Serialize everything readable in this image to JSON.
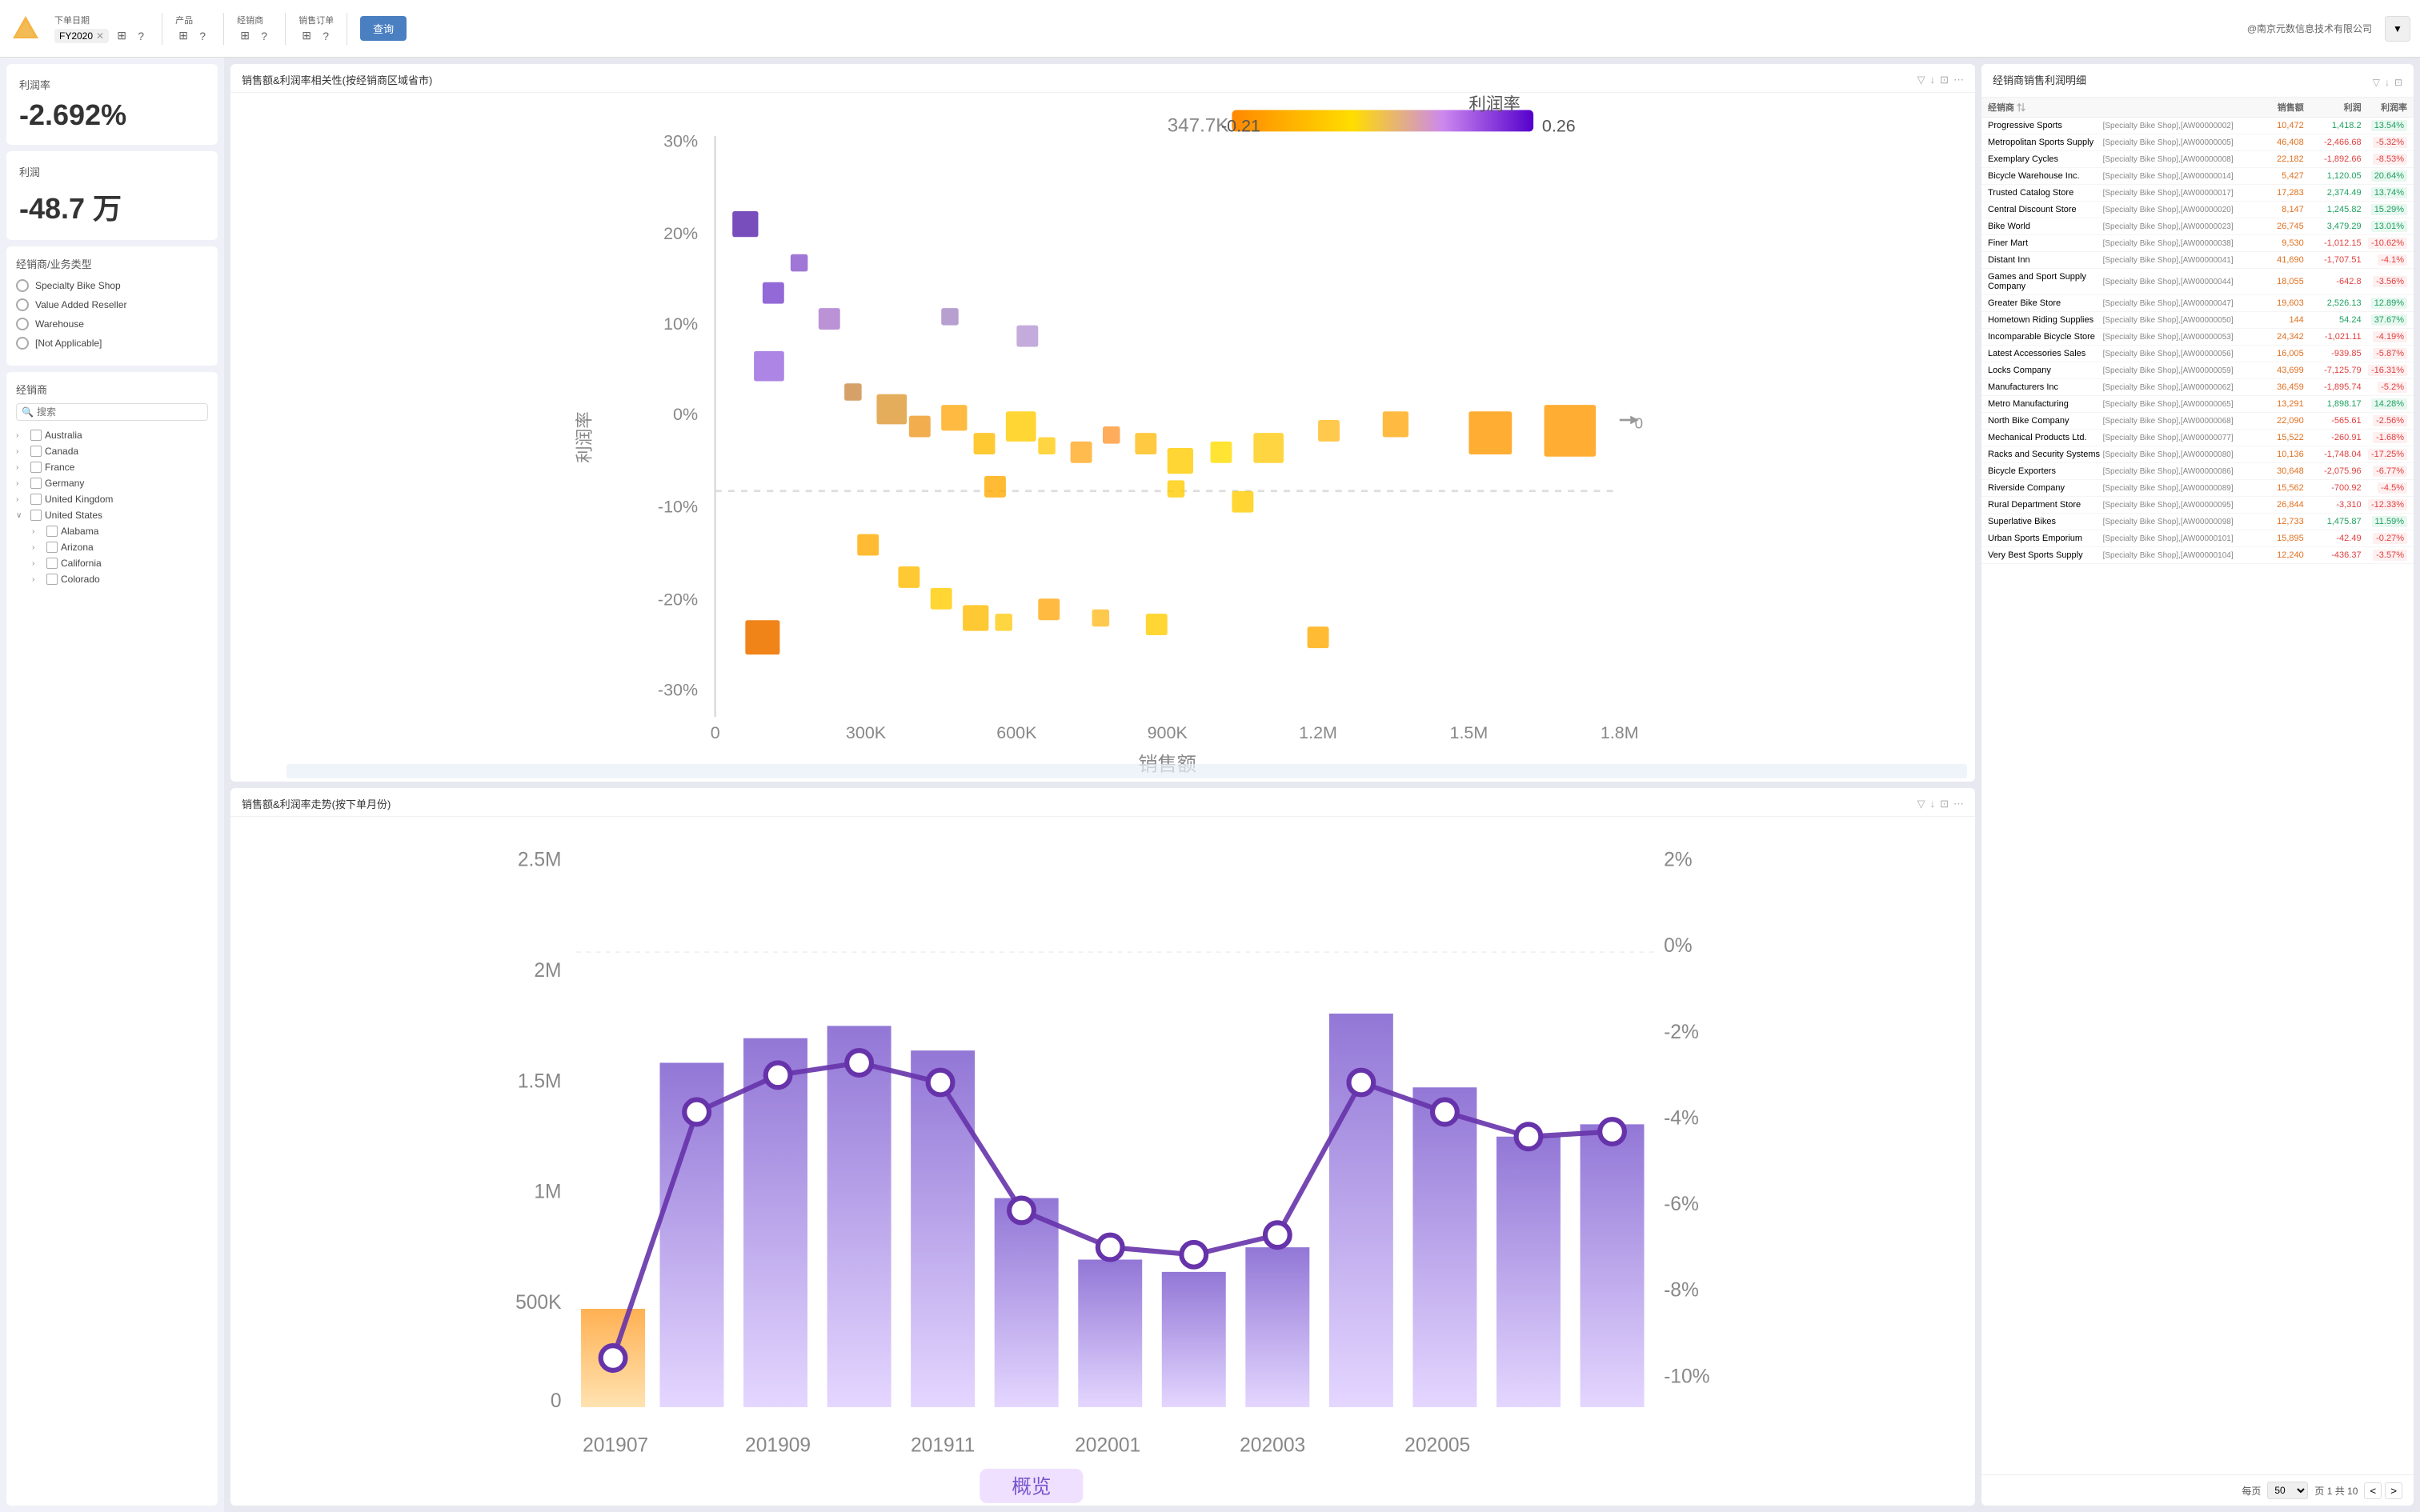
{
  "toolbar": {
    "logo_color": "#f5a623",
    "filters": [
      {
        "label": "下单日期",
        "tag": "FY2020",
        "has_close": true
      },
      {
        "label": "产品",
        "tag": null
      },
      {
        "label": "经销商",
        "tag": null
      },
      {
        "label": "销售订单",
        "tag": null
      }
    ],
    "query_btn": "查询",
    "company": "@南京元数信息技术有限公司"
  },
  "left": {
    "kpi1": {
      "label": "利润率",
      "value": "-2.692%"
    },
    "kpi2": {
      "label": "利润",
      "value": "-48.7 万"
    },
    "filter_title": "经销商/业务类型",
    "filter_items": [
      "Specialty Bike Shop",
      "Value Added Reseller",
      "Warehouse",
      "[Not Applicable]"
    ],
    "tree_title": "经销商",
    "search_placeholder": "搜索",
    "tree_items": [
      {
        "label": "Australia",
        "expanded": false,
        "checked": false,
        "children": []
      },
      {
        "label": "Canada",
        "expanded": false,
        "checked": false,
        "children": []
      },
      {
        "label": "France",
        "expanded": false,
        "checked": false,
        "children": []
      },
      {
        "label": "Germany",
        "expanded": false,
        "checked": false,
        "children": []
      },
      {
        "label": "United Kingdom",
        "expanded": false,
        "checked": false,
        "children": []
      },
      {
        "label": "United States",
        "expanded": true,
        "checked": false,
        "children": [
          "Alabama",
          "Arizona",
          "California",
          "Colorado"
        ]
      }
    ]
  },
  "scatter_chart": {
    "title": "销售额&利润率相关性(按经销商区域省市)",
    "x_label": "销售额",
    "y_label": "利润率",
    "max_bubble": "347.7K",
    "color_min": "-0.21",
    "color_max": "0.26",
    "color_label": "利润率",
    "x_ticks": [
      "0",
      "300K",
      "600K",
      "900K",
      "1.2M",
      "1.5M",
      "1.8M"
    ],
    "y_ticks": [
      "30%",
      "20%",
      "10%",
      "0%",
      "-10%",
      "-20%",
      "-30%"
    ]
  },
  "trend_chart": {
    "title": "销售额&利润率走势(按下单月份)",
    "y_left_ticks": [
      "2.5M",
      "2M",
      "1.5M",
      "1M",
      "500K",
      "0"
    ],
    "y_right_ticks": [
      "2%",
      "0%",
      "-2%",
      "-4%",
      "-6%",
      "-8%",
      "-10%"
    ],
    "x_ticks": [
      "201907",
      "201909",
      "201911",
      "202001",
      "202003",
      "202005"
    ]
  },
  "right_table": {
    "title": "经销商销售利润明细",
    "col_dealer": "经销商",
    "col_id": "",
    "col_sales": "销售额",
    "col_profit": "利润",
    "col_rate": "利润率",
    "rows": [
      {
        "dealer": "Progressive Sports",
        "id": "[Specialty Bike Shop],[AW00000002]",
        "sales": "10,472",
        "profit": "1,418.2",
        "rate": "13.54%",
        "profit_pos": true,
        "rate_pos": true
      },
      {
        "dealer": "Metropolitan Sports Supply",
        "id": "[Specialty Bike Shop],[AW00000005]",
        "sales": "46,408",
        "profit": "-2,466.68",
        "rate": "-5.32%",
        "profit_pos": false,
        "rate_pos": false
      },
      {
        "dealer": "Exemplary Cycles",
        "id": "[Specialty Bike Shop],[AW00000008]",
        "sales": "22,182",
        "profit": "-1,892.66",
        "rate": "-8.53%",
        "profit_pos": false,
        "rate_pos": false
      },
      {
        "dealer": "Bicycle Warehouse Inc.",
        "id": "[Specialty Bike Shop],[AW00000014]",
        "sales": "5,427",
        "profit": "1,120.05",
        "rate": "20.64%",
        "profit_pos": true,
        "rate_pos": true
      },
      {
        "dealer": "Trusted Catalog Store",
        "id": "[Specialty Bike Shop],[AW00000017]",
        "sales": "17,283",
        "profit": "2,374.49",
        "rate": "13.74%",
        "profit_pos": true,
        "rate_pos": true
      },
      {
        "dealer": "Central Discount Store",
        "id": "[Specialty Bike Shop],[AW00000020]",
        "sales": "8,147",
        "profit": "1,245.82",
        "rate": "15.29%",
        "profit_pos": true,
        "rate_pos": true
      },
      {
        "dealer": "Bike World",
        "id": "[Specialty Bike Shop],[AW00000023]",
        "sales": "26,745",
        "profit": "3,479.29",
        "rate": "13.01%",
        "profit_pos": true,
        "rate_pos": true
      },
      {
        "dealer": "Finer Mart",
        "id": "[Specialty Bike Shop],[AW00000038]",
        "sales": "9,530",
        "profit": "-1,012.15",
        "rate": "-10.62%",
        "profit_pos": false,
        "rate_pos": false
      },
      {
        "dealer": "Distant Inn",
        "id": "[Specialty Bike Shop],[AW00000041]",
        "sales": "41,690",
        "profit": "-1,707.51",
        "rate": "-4.1%",
        "profit_pos": false,
        "rate_pos": false
      },
      {
        "dealer": "Games and Sport Supply Company",
        "id": "[Specialty Bike Shop],[AW00000044]",
        "sales": "18,055",
        "profit": "-642.8",
        "rate": "-3.56%",
        "profit_pos": false,
        "rate_pos": false
      },
      {
        "dealer": "Greater Bike Store",
        "id": "[Specialty Bike Shop],[AW00000047]",
        "sales": "19,603",
        "profit": "2,526.13",
        "rate": "12.89%",
        "profit_pos": true,
        "rate_pos": true
      },
      {
        "dealer": "Hometown Riding Supplies",
        "id": "[Specialty Bike Shop],[AW00000050]",
        "sales": "144",
        "profit": "54.24",
        "rate": "37.67%",
        "profit_pos": true,
        "rate_pos": true
      },
      {
        "dealer": "Incomparable Bicycle Store",
        "id": "[Specialty Bike Shop],[AW00000053]",
        "sales": "24,342",
        "profit": "-1,021.11",
        "rate": "-4.19%",
        "profit_pos": false,
        "rate_pos": false
      },
      {
        "dealer": "Latest Accessories Sales",
        "id": "[Specialty Bike Shop],[AW00000056]",
        "sales": "16,005",
        "profit": "-939.85",
        "rate": "-5.87%",
        "profit_pos": false,
        "rate_pos": false
      },
      {
        "dealer": "Locks Company",
        "id": "[Specialty Bike Shop],[AW00000059]",
        "sales": "43,699",
        "profit": "-7,125.79",
        "rate": "-16.31%",
        "profit_pos": false,
        "rate_pos": false
      },
      {
        "dealer": "Manufacturers Inc",
        "id": "[Specialty Bike Shop],[AW00000062]",
        "sales": "36,459",
        "profit": "-1,895.74",
        "rate": "-5.2%",
        "profit_pos": false,
        "rate_pos": false
      },
      {
        "dealer": "Metro Manufacturing",
        "id": "[Specialty Bike Shop],[AW00000065]",
        "sales": "13,291",
        "profit": "1,898.17",
        "rate": "14.28%",
        "profit_pos": true,
        "rate_pos": true
      },
      {
        "dealer": "North Bike Company",
        "id": "[Specialty Bike Shop],[AW00000068]",
        "sales": "22,090",
        "profit": "-565.61",
        "rate": "-2.56%",
        "profit_pos": false,
        "rate_pos": false
      },
      {
        "dealer": "Mechanical Products Ltd.",
        "id": "[Specialty Bike Shop],[AW00000077]",
        "sales": "15,522",
        "profit": "-260.91",
        "rate": "-1.68%",
        "profit_pos": false,
        "rate_pos": false
      },
      {
        "dealer": "Racks and Security Systems",
        "id": "[Specialty Bike Shop],[AW00000080]",
        "sales": "10,136",
        "profit": "-1,748.04",
        "rate": "-17.25%",
        "profit_pos": false,
        "rate_pos": false
      },
      {
        "dealer": "Bicycle Exporters",
        "id": "[Specialty Bike Shop],[AW00000086]",
        "sales": "30,648",
        "profit": "-2,075.96",
        "rate": "-6.77%",
        "profit_pos": false,
        "rate_pos": false
      },
      {
        "dealer": "Riverside Company",
        "id": "[Specialty Bike Shop],[AW00000089]",
        "sales": "15,562",
        "profit": "-700.92",
        "rate": "-4.5%",
        "profit_pos": false,
        "rate_pos": false
      },
      {
        "dealer": "Rural Department Store",
        "id": "[Specialty Bike Shop],[AW00000095]",
        "sales": "26,844",
        "profit": "-3,310",
        "rate": "-12.33%",
        "profit_pos": false,
        "rate_pos": false
      },
      {
        "dealer": "Superlative Bikes",
        "id": "[Specialty Bike Shop],[AW00000098]",
        "sales": "12,733",
        "profit": "1,475.87",
        "rate": "11.59%",
        "profit_pos": true,
        "rate_pos": true
      },
      {
        "dealer": "Urban Sports Emporium",
        "id": "[Specialty Bike Shop],[AW00000101]",
        "sales": "15,895",
        "profit": "-42.49",
        "rate": "-0.27%",
        "profit_pos": false,
        "rate_pos": false
      },
      {
        "dealer": "Very Best Sports Supply",
        "id": "[Specialty Bike Shop],[AW00000104]",
        "sales": "12,240",
        "profit": "-436.37",
        "rate": "-3.57%",
        "profit_pos": false,
        "rate_pos": false
      }
    ],
    "footer": {
      "per_page_label": "每页",
      "per_page_value": "50",
      "page_info": "页 1 共 10"
    }
  }
}
